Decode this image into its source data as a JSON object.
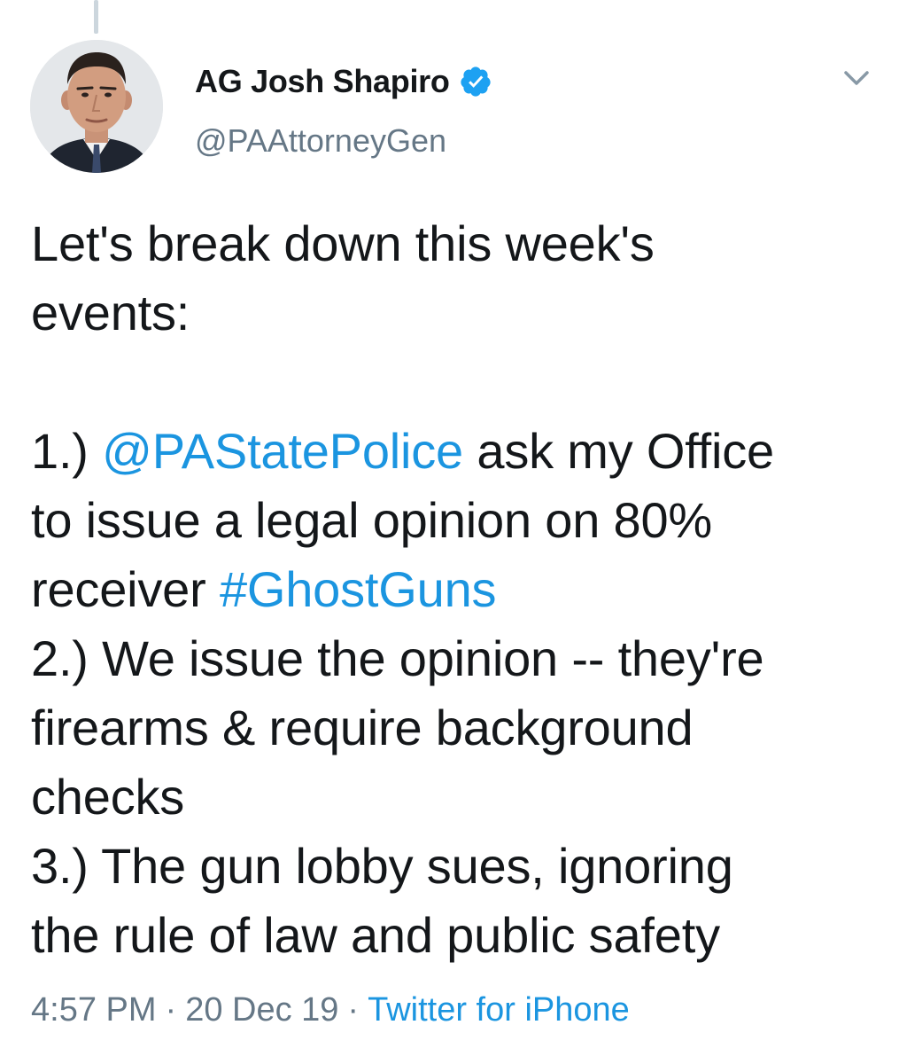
{
  "tweet": {
    "display_name": "AG Josh Shapiro",
    "handle": "@PAAttorneyGen",
    "verified": true,
    "body": {
      "line1": "Let's break down this week's",
      "line2": "events:",
      "item1_prefix": "1.) ",
      "item1_mention": "@PAStatePolice",
      "item1_rest": " ask my Office",
      "item1_line2": "to issue a legal opinion on 80%",
      "item1_line3_prefix": "receiver ",
      "item1_hashtag": "#GhostGuns",
      "item2_line1": "2.) We issue the opinion -- they're",
      "item2_line2": "firearms & require background",
      "item2_line3": "checks",
      "item3_line1": "3.) The gun lobby sues, ignoring",
      "item3_line2": "the rule of law and public safety"
    },
    "time": "4:57 PM",
    "separator": "·",
    "date": "20 Dec 19",
    "source": "Twitter for iPhone"
  },
  "icons": {
    "verified": "verified-badge-icon",
    "menu": "chevron-down-icon",
    "avatar": "profile-photo"
  },
  "colors": {
    "link": "#1b95e0",
    "muted": "#657786",
    "text": "#14171a",
    "verified": "#1da1f2",
    "thread_line": "#ccd6dd"
  }
}
